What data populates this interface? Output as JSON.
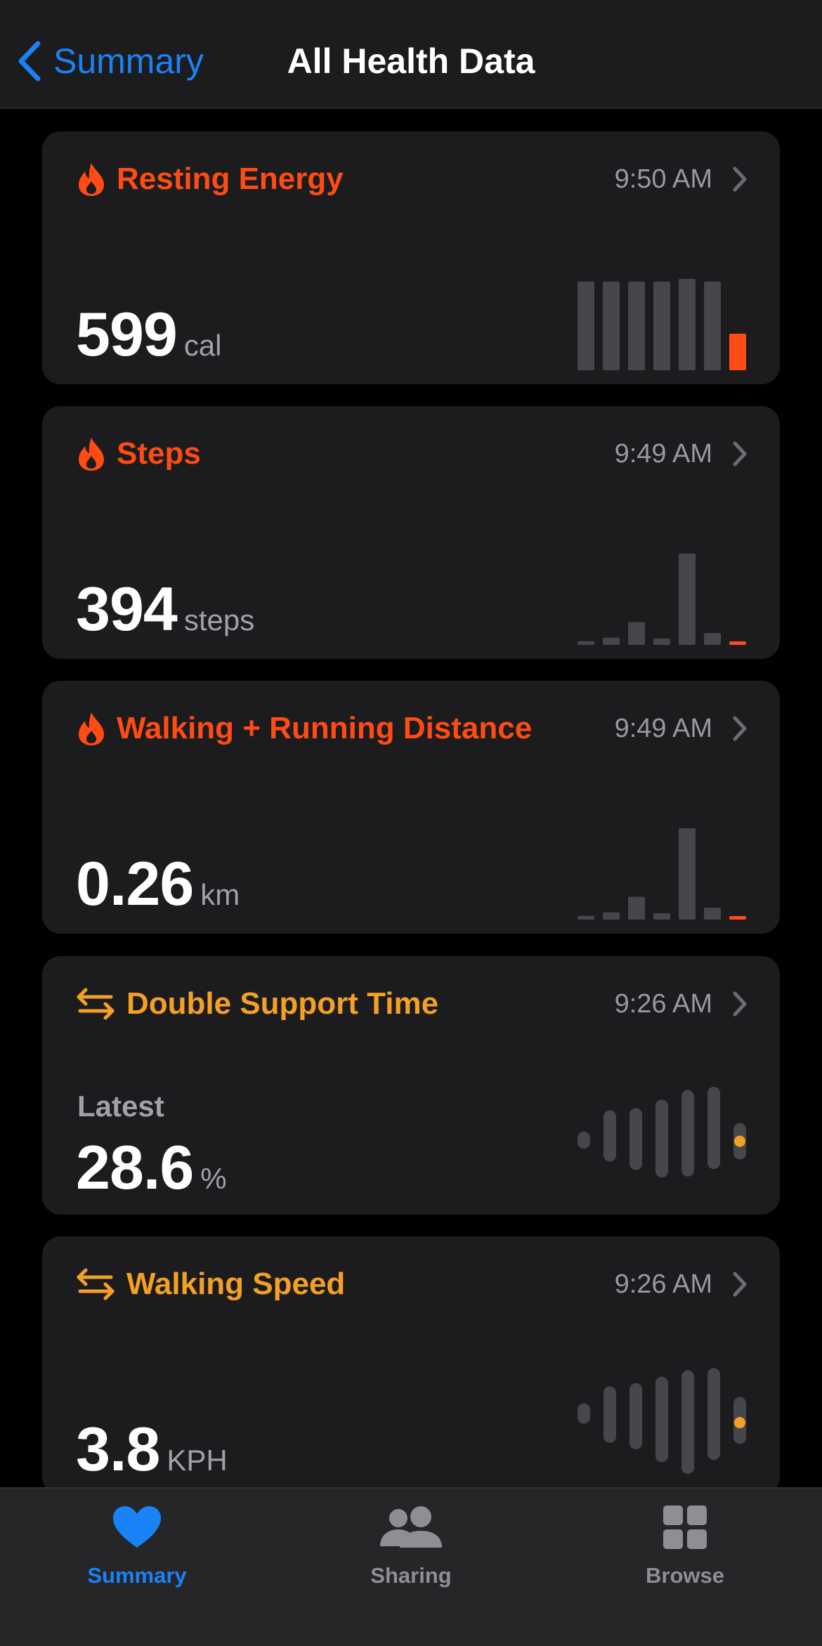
{
  "nav": {
    "back_label": "Summary",
    "title": "All Health Data"
  },
  "colors": {
    "accent": "#1a82f7",
    "activity": "#ff4b14",
    "mobility": "#f4a024",
    "bar": "#47474b",
    "background": "#000000",
    "card": "#1c1c1e"
  },
  "cards": [
    {
      "title": "Resting Energy",
      "icon": "flame-icon",
      "time": "9:50 AM",
      "value": "599",
      "unit": "cal",
      "sublabel": "",
      "chart_data": {
        "type": "bar",
        "values": [
          0.97,
          0.97,
          0.97,
          0.97,
          1.0,
          0.97,
          0.4
        ],
        "highlight_last": true
      }
    },
    {
      "title": "Steps",
      "icon": "flame-icon",
      "time": "9:49 AM",
      "value": "394",
      "unit": "steps",
      "sublabel": "",
      "chart_data": {
        "type": "bar",
        "values": [
          0.04,
          0.08,
          0.25,
          0.07,
          1.0,
          0.13,
          0.02
        ],
        "highlight_last": true
      }
    },
    {
      "title": "Walking + Running Distance",
      "icon": "flame-icon",
      "time": "9:49 AM",
      "value": "0.26",
      "unit": "km",
      "sublabel": "",
      "chart_data": {
        "type": "bar",
        "values": [
          0.04,
          0.08,
          0.25,
          0.07,
          1.0,
          0.13,
          0.02
        ],
        "highlight_last": true
      }
    },
    {
      "title": "Double Support Time",
      "icon": "arrows-swap-icon",
      "time": "9:26 AM",
      "value": "28.6",
      "unit": "%",
      "sublabel": "Latest",
      "chart_data": {
        "type": "range",
        "ranges": [
          [
            0.42,
            0.58
          ],
          [
            0.3,
            0.78
          ],
          [
            0.22,
            0.8
          ],
          [
            0.15,
            0.88
          ],
          [
            0.16,
            0.97
          ],
          [
            0.23,
            1.0
          ],
          [
            0.32,
            0.66
          ]
        ],
        "latest": 0.49
      }
    },
    {
      "title": "Walking Speed",
      "icon": "arrows-swap-icon",
      "time": "9:26 AM",
      "value": "3.8",
      "unit": "KPH",
      "sublabel": "",
      "chart_data": {
        "type": "range",
        "ranges": [
          [
            0.47,
            0.66
          ],
          [
            0.29,
            0.82
          ],
          [
            0.23,
            0.85
          ],
          [
            0.11,
            0.91
          ],
          [
            0.0,
            0.97
          ],
          [
            0.13,
            0.99
          ],
          [
            0.28,
            0.72
          ]
        ],
        "latest": 0.48
      }
    }
  ],
  "tabs": [
    {
      "label": "Summary",
      "icon": "heart-icon",
      "active": true
    },
    {
      "label": "Sharing",
      "icon": "people-icon",
      "active": false
    },
    {
      "label": "Browse",
      "icon": "grid-icon",
      "active": false
    }
  ]
}
